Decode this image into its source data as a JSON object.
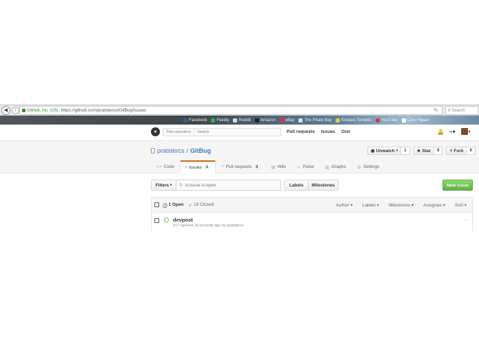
{
  "browser": {
    "site_identity": "GitHub, Inc. (US)",
    "url": "https://github.com/pratstercs/GitBug/issues",
    "search_placeholder": "Search",
    "bookmarks": [
      {
        "label": "Facebook",
        "color": "#3b5998"
      },
      {
        "label": "Feedly",
        "color": "#2bb24c"
      },
      {
        "label": "Reddit",
        "color": "#cee3f8"
      },
      {
        "label": "Amazon",
        "color": "#222222"
      },
      {
        "label": "eBay",
        "color": "#e53238"
      },
      {
        "label": "The Pirate Bay",
        "color": "#dddddd"
      },
      {
        "label": "Kickass Torrents",
        "color": "#e8c84a"
      },
      {
        "label": "YouTube",
        "color": "#e52d27"
      },
      {
        "label": "Coin Flipper",
        "color": "#ffffff"
      }
    ]
  },
  "header": {
    "scope_label": "This repository",
    "search_placeholder": "Search",
    "nav": [
      "Pull requests",
      "Issues",
      "Gist"
    ]
  },
  "repo": {
    "owner": "pratstercs",
    "separator": "/",
    "name": "GitBug",
    "watch": {
      "label": "Unwatch",
      "count": "1"
    },
    "star": {
      "label": "Star",
      "count": "0"
    },
    "fork": {
      "label": "Fork",
      "count": "0"
    }
  },
  "tabs": [
    {
      "label": "Code",
      "icon": "<>",
      "counter": ""
    },
    {
      "label": "Issues",
      "icon": "!",
      "counter": "1"
    },
    {
      "label": "Pull requests",
      "icon": "⑂",
      "counter": "0"
    },
    {
      "label": "Wiki",
      "icon": "▤",
      "counter": ""
    },
    {
      "label": "Pulse",
      "icon": "∿",
      "counter": ""
    },
    {
      "label": "Graphs",
      "icon": "▥",
      "counter": ""
    },
    {
      "label": "Settings",
      "icon": "⚙",
      "counter": ""
    }
  ],
  "subnav": {
    "filters_label": "Filters",
    "filter_value": "is:issue is:open",
    "labels_label": "Labels",
    "milestones_label": "Milestones",
    "new_issue_label": "New issue"
  },
  "issues_table": {
    "open_label": "1 Open",
    "closed_label": "16 Closed",
    "sorts": [
      "Author",
      "Labels",
      "Milestones",
      "Assignee",
      "Sort"
    ],
    "rows": [
      {
        "title": "devpost",
        "meta": "#17 opened 16 seconds ago by pratstercs"
      }
    ]
  },
  "colors": {
    "link": "#4078c0",
    "tab_accent": "#d26911",
    "new_issue_green": "#60b044",
    "open_issue_green": "#6cc644"
  }
}
